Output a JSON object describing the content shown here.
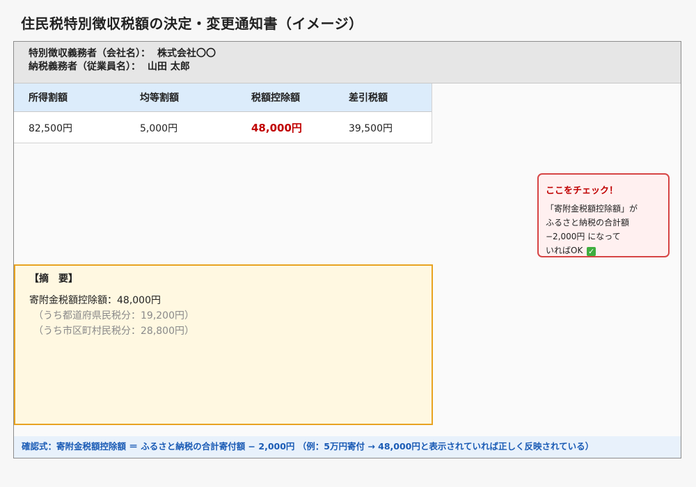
{
  "page": {
    "title": "住民税特別徴収税額の決定・変更通知書（イメージ）"
  },
  "header": {
    "employer_label": "特別徴収義務者（会社名）：",
    "employer_value": "株式会社〇〇",
    "employee_label": "納税義務者（従業員名）：",
    "employee_value": "山田 太郎"
  },
  "amounts": {
    "columns": [
      "所得割額",
      "均等割額",
      "税額控除額",
      "差引税額"
    ],
    "values": [
      "82,500円",
      "5,000円",
      "48,000円",
      "39,500円"
    ],
    "highlight_color": "#c00000"
  },
  "summary": {
    "title": "【摘　要】",
    "main": "寄附金税額控除額：48,000円",
    "sub1": "（うち都道府県民税分：19,200円）",
    "sub2": "（うち市区町村民税分：28,800円）"
  },
  "callout": {
    "title": "ここをチェック！",
    "line1": "「寄附金税額控除額」が",
    "line2": "ふるさと納税の合計額",
    "line3": "−2,000円 になって",
    "line4": "いればOK",
    "ok_icon": "check-mark-button-icon",
    "arrow_color": "#e53935"
  },
  "formula": {
    "text": "確認式：寄附金税額控除額 ＝ ふるさと納税の合計寄付額 − 2,000円 （例：5万円寄付 → 48,000円と表示されていれば正しく反映されている）"
  }
}
